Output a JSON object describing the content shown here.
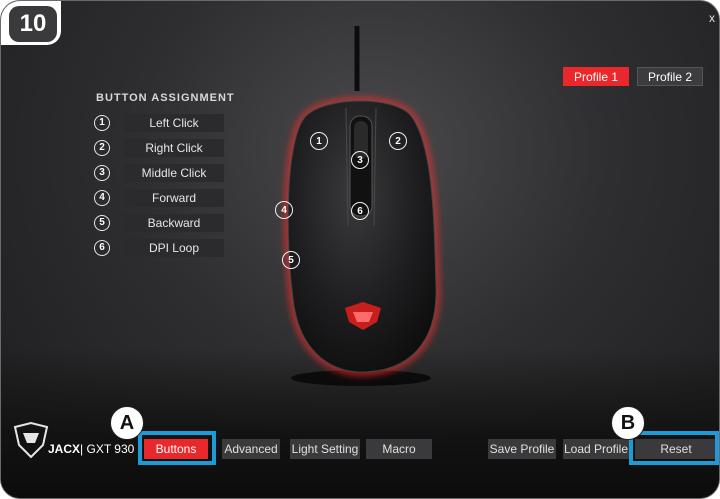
{
  "step_number": "10",
  "close_label": "x",
  "profiles": [
    {
      "label": "Profile 1",
      "active": true
    },
    {
      "label": "Profile 2",
      "active": false
    }
  ],
  "button_assignment": {
    "title": "BUTTON ASSIGNMENT",
    "items": [
      {
        "num": "1",
        "label": "Left Click"
      },
      {
        "num": "2",
        "label": "Right Click"
      },
      {
        "num": "3",
        "label": "Middle Click"
      },
      {
        "num": "4",
        "label": "Forward"
      },
      {
        "num": "5",
        "label": "Backward"
      },
      {
        "num": "6",
        "label": "DPI Loop"
      }
    ]
  },
  "mouse_markers": [
    "1",
    "2",
    "3",
    "4",
    "5",
    "6"
  ],
  "brand": {
    "model_bold": "JACX",
    "separator": "|",
    "model_code": "GXT 930"
  },
  "tabs": [
    {
      "label": "Buttons",
      "active": true
    },
    {
      "label": "Advanced",
      "active": false
    },
    {
      "label": "Light Setting",
      "active": false
    },
    {
      "label": "Macro",
      "active": false
    }
  ],
  "actions": {
    "save": "Save Profile",
    "load": "Load Profile",
    "reset": "Reset"
  },
  "callouts": {
    "a": "A",
    "b": "B"
  },
  "colors": {
    "accent": "#e8282b",
    "highlight": "#1e9ad6",
    "panel": "#2b2b2d"
  }
}
